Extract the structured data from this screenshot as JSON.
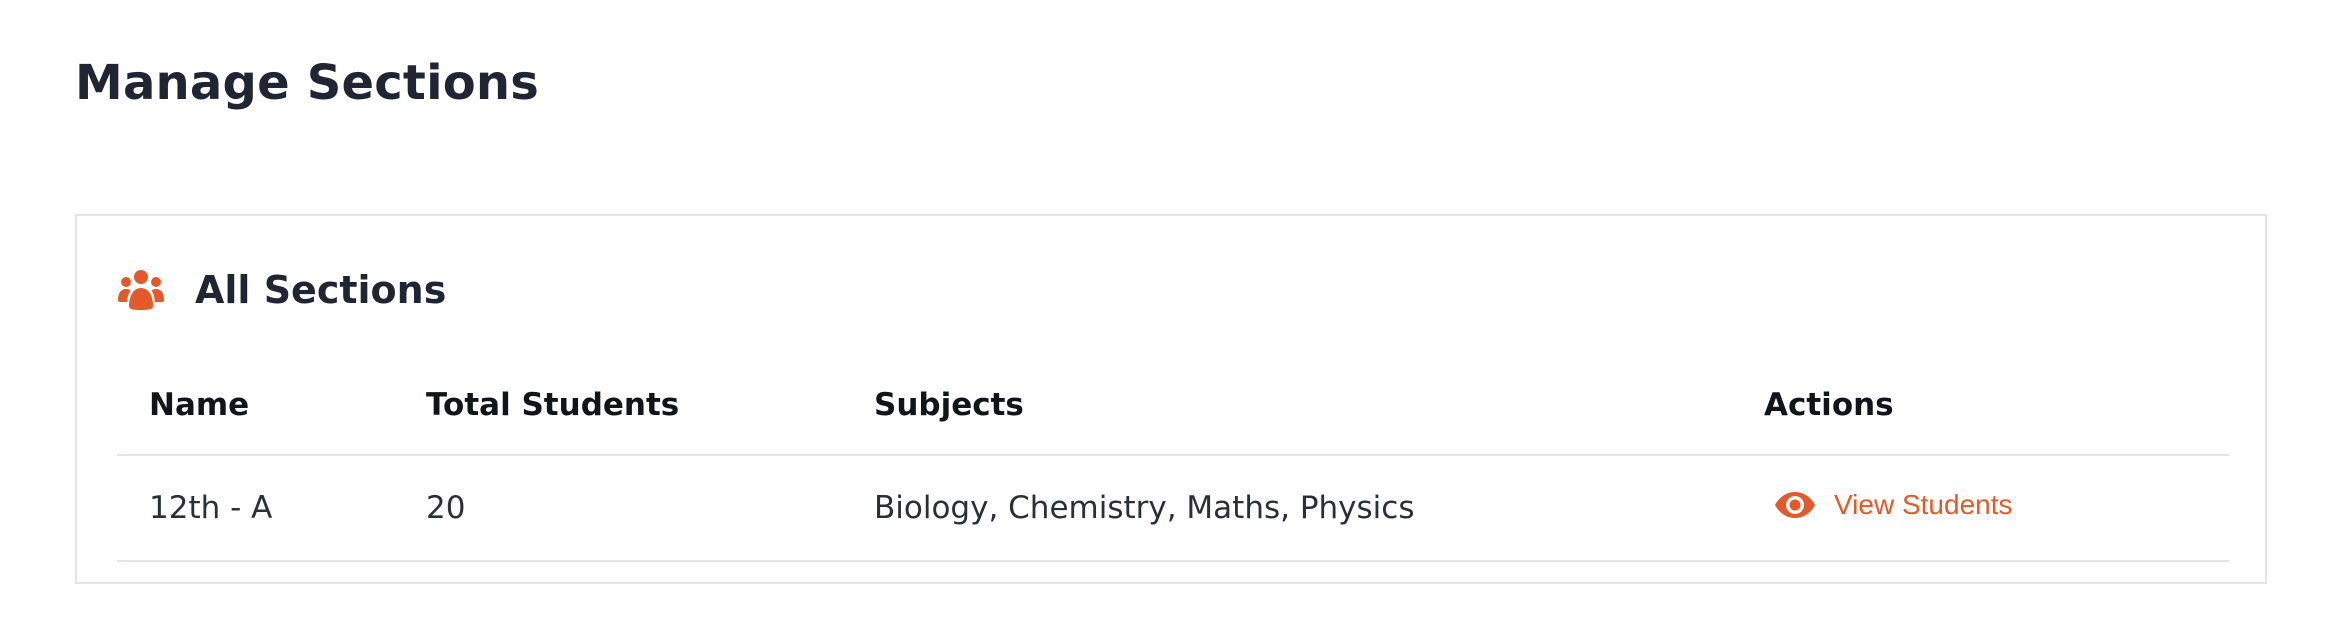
{
  "page": {
    "title": "Manage Sections"
  },
  "card": {
    "icon": "users-icon",
    "title": "All Sections"
  },
  "table": {
    "headers": {
      "name": "Name",
      "total_students": "Total Students",
      "subjects": "Subjects",
      "actions": "Actions"
    },
    "rows": [
      {
        "name": "12th - A",
        "total_students": "20",
        "subjects": "Biology, Chemistry, Maths, Physics",
        "action": {
          "icon": "eye-icon",
          "label": "View Students"
        }
      }
    ]
  },
  "colors": {
    "accent": "#e4592a",
    "title_text": "#1f2532",
    "border": "#e2e4e8"
  }
}
